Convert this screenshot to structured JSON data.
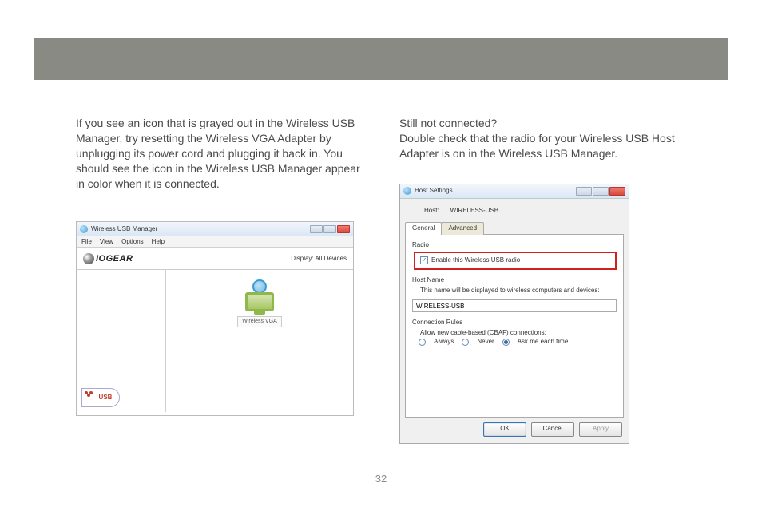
{
  "page_number": "32",
  "left_column": {
    "paragraph": "If you see an icon that is grayed out in the Wireless USB Manager, try resetting the Wireless VGA Adapter by unplugging its power cord and plugging it back in. You should see the icon in the Wireless USB Manager appear in color when it is connected."
  },
  "right_column": {
    "heading": "Still not connected?",
    "paragraph": "Double check that the radio for your Wireless USB Host Adapter is on in the Wireless USB Manager."
  },
  "shot1": {
    "title": "Wireless USB Manager",
    "menu": {
      "file": "File",
      "view": "View",
      "options": "Options",
      "help": "Help"
    },
    "brand_text": "IOGEAR",
    "display_label": "Display:  All Devices",
    "usb_logo_text": "USB",
    "device_label": "Wireless VGA"
  },
  "shot2": {
    "title": "Host Settings",
    "host_label": "Host:",
    "host_value": "WIRELESS-USB",
    "tabs": {
      "general": "General",
      "advanced": "Advanced"
    },
    "radio_group": "Radio",
    "enable_radio_label": "Enable this Wireless USB radio",
    "hostname_group": "Host Name",
    "hostname_help": "This name will be displayed to wireless computers and devices:",
    "hostname_value": "WIRELESS-USB",
    "rules_group": "Connection Rules",
    "rules_help": "Allow new cable-based (CBAF) connections:",
    "rules": {
      "always": "Always",
      "never": "Never",
      "ask": "Ask me each time"
    },
    "buttons": {
      "ok": "OK",
      "cancel": "Cancel",
      "apply": "Apply"
    }
  }
}
